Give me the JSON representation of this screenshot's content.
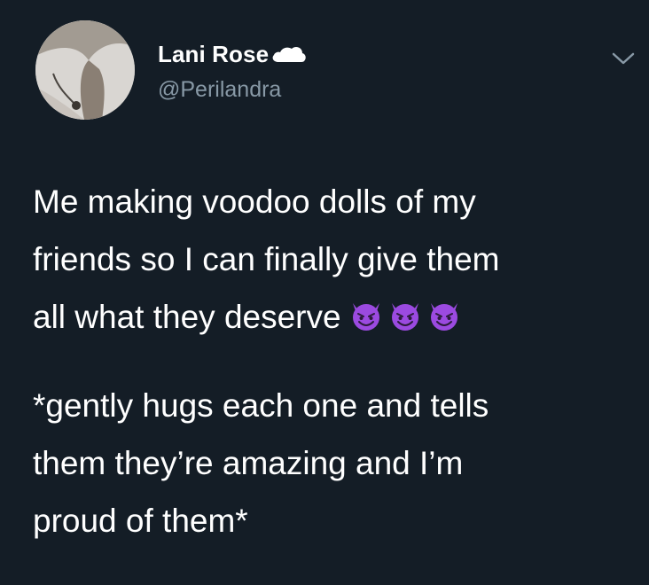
{
  "tweet": {
    "display_name": "Lani Rose",
    "handle": "@Perilandra",
    "paragraph1_lines": [
      "Me making voodoo dolls of my",
      "friends so I can finally give them",
      "all what they deserve"
    ],
    "paragraph1_emojis": [
      "smiling-devil-icon",
      "smiling-devil-icon",
      "smiling-devil-icon"
    ],
    "paragraph2_lines": [
      "*gently hugs each one and tells",
      "them they’re amazing and I’m",
      "proud of them*"
    ]
  },
  "icons": {
    "name_badge": "cloud-icon",
    "menu": "chevron-down-icon"
  },
  "colors": {
    "background": "#141d26",
    "text": "#ffffff",
    "handle": "#8899a6",
    "emoji_purple": "#9b4ae0"
  }
}
